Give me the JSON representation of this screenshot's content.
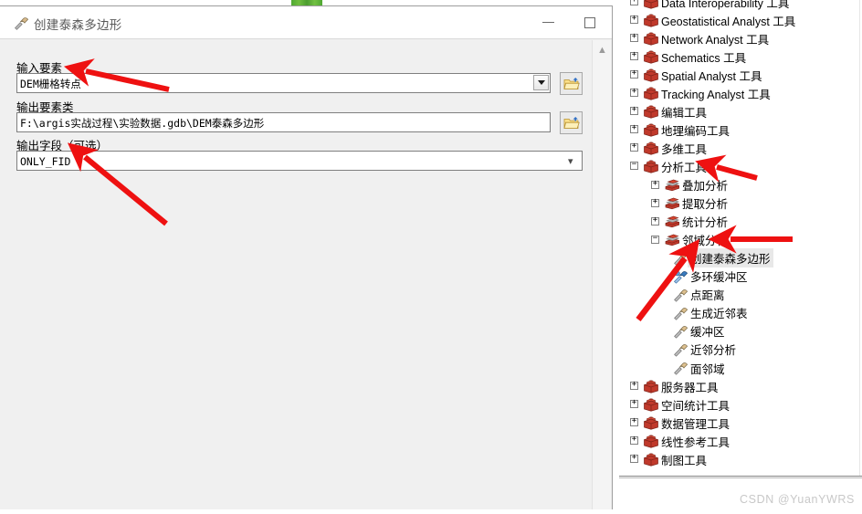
{
  "dialog": {
    "title": "创建泰森多边形",
    "title_icon": "hammer-tool-icon",
    "window_controls": {
      "minimize": "minimize-icon",
      "maximize": "maximize-icon",
      "close": "close-icon"
    },
    "params": [
      {
        "label": "输入要素",
        "value": "DEM栅格转点",
        "control": "combobox",
        "browse": "open-folder-icon"
      },
      {
        "label": "输出要素类",
        "value": "F:\\argis实战过程\\实验数据.gdb\\DEM泰森多边形",
        "control": "textbox",
        "browse": "open-folder-icon"
      },
      {
        "label": "输出字段（可选）",
        "value": "ONLY_FID",
        "control": "dropdown",
        "browse": ""
      }
    ],
    "scroll_up_glyph": "chevron-up-icon"
  },
  "toolbox_tree": {
    "nodes": [
      {
        "label": "Data Interoperability 工具",
        "indent": 0,
        "expander": "+",
        "icon": "toolbox-icon",
        "selected": false,
        "clipped": true
      },
      {
        "label": "Geostatistical Analyst 工具",
        "indent": 0,
        "expander": "+",
        "icon": "toolbox-icon",
        "selected": false
      },
      {
        "label": "Network Analyst 工具",
        "indent": 0,
        "expander": "+",
        "icon": "toolbox-icon",
        "selected": false
      },
      {
        "label": "Schematics 工具",
        "indent": 0,
        "expander": "+",
        "icon": "toolbox-icon",
        "selected": false
      },
      {
        "label": "Spatial Analyst 工具",
        "indent": 0,
        "expander": "+",
        "icon": "toolbox-icon",
        "selected": false
      },
      {
        "label": "Tracking Analyst 工具",
        "indent": 0,
        "expander": "+",
        "icon": "toolbox-icon",
        "selected": false
      },
      {
        "label": "编辑工具",
        "indent": 0,
        "expander": "+",
        "icon": "toolbox-icon",
        "selected": false
      },
      {
        "label": "地理编码工具",
        "indent": 0,
        "expander": "+",
        "icon": "toolbox-icon",
        "selected": false
      },
      {
        "label": "多维工具",
        "indent": 0,
        "expander": "+",
        "icon": "toolbox-icon",
        "selected": false
      },
      {
        "label": "分析工具",
        "indent": 0,
        "expander": "-",
        "icon": "toolbox-icon",
        "selected": false
      },
      {
        "label": "叠加分析",
        "indent": 1,
        "expander": "+",
        "icon": "toolset-icon",
        "selected": false
      },
      {
        "label": "提取分析",
        "indent": 1,
        "expander": "+",
        "icon": "toolset-icon",
        "selected": false
      },
      {
        "label": "统计分析",
        "indent": 1,
        "expander": "+",
        "icon": "toolset-icon",
        "selected": false
      },
      {
        "label": "邻域分析",
        "indent": 1,
        "expander": "-",
        "icon": "toolset-icon",
        "selected": false
      },
      {
        "label": "创建泰森多边形",
        "indent": 2,
        "expander": "",
        "icon": "hammer-tool-icon",
        "selected": true
      },
      {
        "label": "多环缓冲区",
        "indent": 2,
        "expander": "",
        "icon": "script-tool-icon",
        "selected": false
      },
      {
        "label": "点距离",
        "indent": 2,
        "expander": "",
        "icon": "hammer-tool-icon",
        "selected": false
      },
      {
        "label": "生成近邻表",
        "indent": 2,
        "expander": "",
        "icon": "hammer-tool-icon",
        "selected": false
      },
      {
        "label": "缓冲区",
        "indent": 2,
        "expander": "",
        "icon": "hammer-tool-icon",
        "selected": false
      },
      {
        "label": "近邻分析",
        "indent": 2,
        "expander": "",
        "icon": "hammer-tool-icon",
        "selected": false
      },
      {
        "label": "面邻域",
        "indent": 2,
        "expander": "",
        "icon": "hammer-tool-icon",
        "selected": false
      },
      {
        "label": "服务器工具",
        "indent": 0,
        "expander": "+",
        "icon": "toolbox-icon",
        "selected": false
      },
      {
        "label": "空间统计工具",
        "indent": 0,
        "expander": "+",
        "icon": "toolbox-icon",
        "selected": false
      },
      {
        "label": "数据管理工具",
        "indent": 0,
        "expander": "+",
        "icon": "toolbox-icon",
        "selected": false
      },
      {
        "label": "线性参考工具",
        "indent": 0,
        "expander": "+",
        "icon": "toolbox-icon",
        "selected": false
      },
      {
        "label": "制图工具",
        "indent": 0,
        "expander": "+",
        "icon": "toolbox-icon",
        "selected": false
      }
    ]
  },
  "annotations": {
    "arrow_color": "#ee1111",
    "arrows": [
      {
        "name": "arrow-to-input-features"
      },
      {
        "name": "arrow-to-output-field"
      },
      {
        "name": "arrow-to-analysis-tools"
      },
      {
        "name": "arrow-to-proximity-toolset"
      },
      {
        "name": "arrow-to-create-thiessen-polygons"
      }
    ]
  },
  "watermark": {
    "text": "CSDN @YuanYWRS"
  }
}
